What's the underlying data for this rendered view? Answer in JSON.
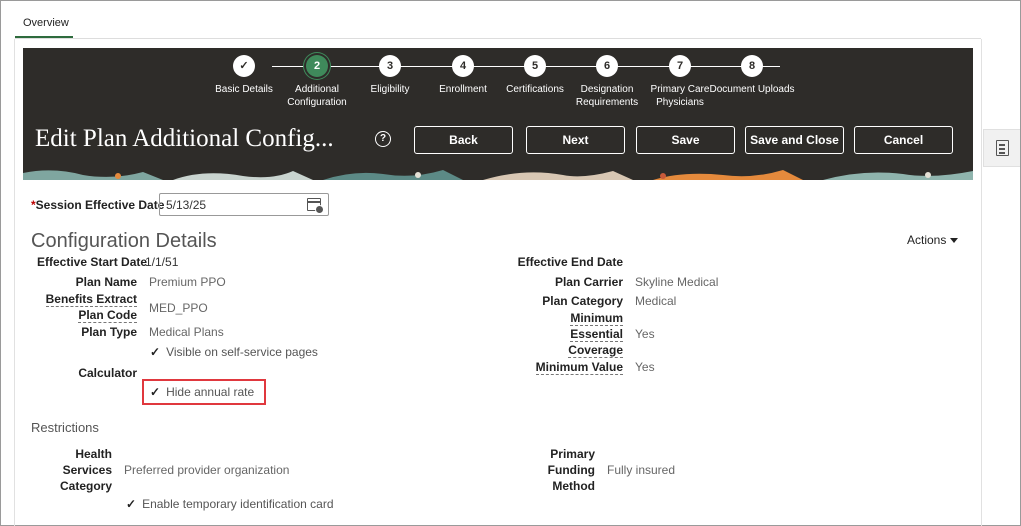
{
  "tabs": {
    "overview": "Overview"
  },
  "train": {
    "steps": [
      {
        "number": "✓",
        "label": "Basic Details",
        "state": "done"
      },
      {
        "number": "2",
        "label": "Additional Configuration",
        "state": "current"
      },
      {
        "number": "3",
        "label": "Eligibility",
        "state": "todo"
      },
      {
        "number": "4",
        "label": "Enrollment",
        "state": "todo"
      },
      {
        "number": "5",
        "label": "Certifications",
        "state": "todo"
      },
      {
        "number": "6",
        "label": "Designation Requirements",
        "state": "todo"
      },
      {
        "number": "7",
        "label": "Primary Care Physicians",
        "state": "todo"
      },
      {
        "number": "8",
        "label": "Document Uploads",
        "state": "todo"
      }
    ]
  },
  "header": {
    "title": "Edit Plan Additional Config...",
    "help": "?",
    "buttons": {
      "back": "Back",
      "next": "Next",
      "save": "Save",
      "save_close": "Save and Close",
      "cancel": "Cancel"
    }
  },
  "session": {
    "label": "Session Effective Date",
    "value": "5/13/25"
  },
  "config": {
    "title": "Configuration Details",
    "actions": "Actions",
    "effective_start_label": "Effective Start Date",
    "effective_start_value": "1/1/51",
    "effective_end_label": "Effective End Date",
    "plan_name_label": "Plan Name",
    "plan_name_value": "Premium PPO",
    "benefits_extract_label_1": "Benefits Extract",
    "benefits_extract_label_2": "Plan Code",
    "benefits_extract_value": "MED_PPO",
    "plan_type_label": "Plan Type",
    "plan_type_value": "Medical Plans",
    "visible_self_service": "Visible on self-service pages",
    "calculator_label": "Calculator",
    "hide_annual_rate": "Hide annual rate",
    "plan_carrier_label": "Plan Carrier",
    "plan_carrier_value": "Skyline Medical",
    "plan_category_label": "Plan Category",
    "plan_category_value": "Medical",
    "min_essential_label_1": "Minimum",
    "min_essential_label_2": "Essential",
    "min_essential_label_3": "Coverage",
    "min_essential_value": "Yes",
    "min_value_label": "Minimum Value",
    "min_value_value": "Yes"
  },
  "restrictions": {
    "title": "Restrictions",
    "hsc_label_1": "Health",
    "hsc_label_2": "Services",
    "hsc_label_3": "Category",
    "hsc_value": "Preferred provider organization",
    "pfm_label_1": "Primary",
    "pfm_label_2": "Funding",
    "pfm_label_3": "Method",
    "pfm_value": "Fully insured",
    "temp_id_card": "Enable temporary identification card"
  },
  "colors": {
    "banner": "#2e2c29",
    "current_step": "#3f8a5b",
    "highlight": "#e0383e"
  }
}
